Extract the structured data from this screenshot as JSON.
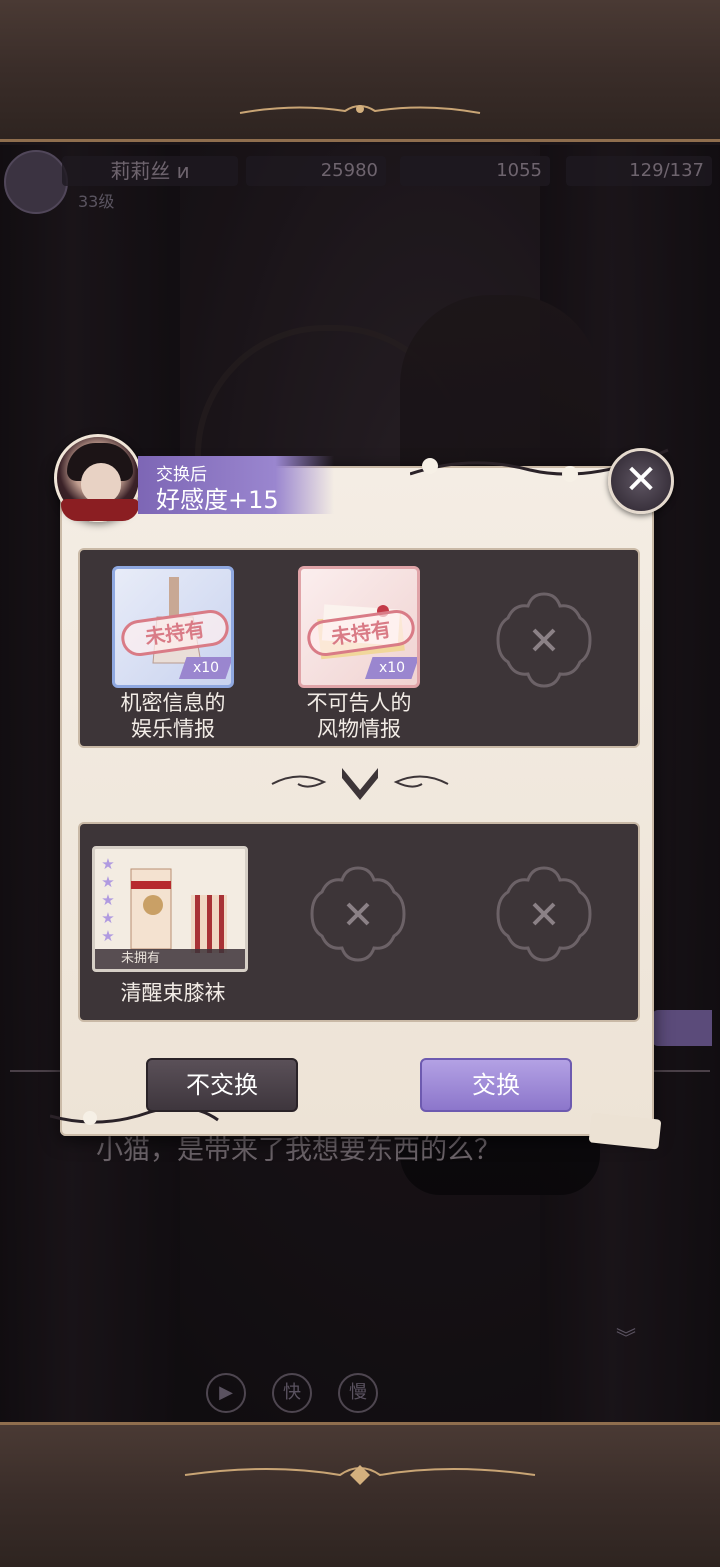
{
  "hud": {
    "player_name": "莉莉丝 и",
    "level": "33级",
    "gold": "25980",
    "diamonds": "1055",
    "stamina": "129/137"
  },
  "dialog": {
    "line": "小猫，是带来了我想要东西的么？",
    "controls": {
      "play": "▶",
      "fast": "快",
      "slow": "慢"
    }
  },
  "popup": {
    "header_small": "交换后",
    "header_big": "好感度+15",
    "close_glyph": "✕",
    "offer_items": [
      {
        "name_line1": "机密信息的",
        "name_line2": "娱乐情报",
        "stamp": "未持有",
        "qty": "x10",
        "icon": "bottle-icon"
      },
      {
        "name_line1": "不可告人的",
        "name_line2": "风物情报",
        "stamp": "未持有",
        "qty": "x10",
        "icon": "letter-icon"
      }
    ],
    "reward_items": [
      {
        "name": "清醒束膝袜",
        "status": "未拥有",
        "stars": "★★★★★",
        "icon": "garter-stocking-icon"
      }
    ],
    "buttons": {
      "cancel": "不交换",
      "confirm": "交换"
    }
  },
  "colors": {
    "accent_purple": "#9a86cf",
    "panel_bg": "#f4ede4",
    "tray_bg": "#3d3538",
    "stamp_pink": "#d97b86"
  }
}
